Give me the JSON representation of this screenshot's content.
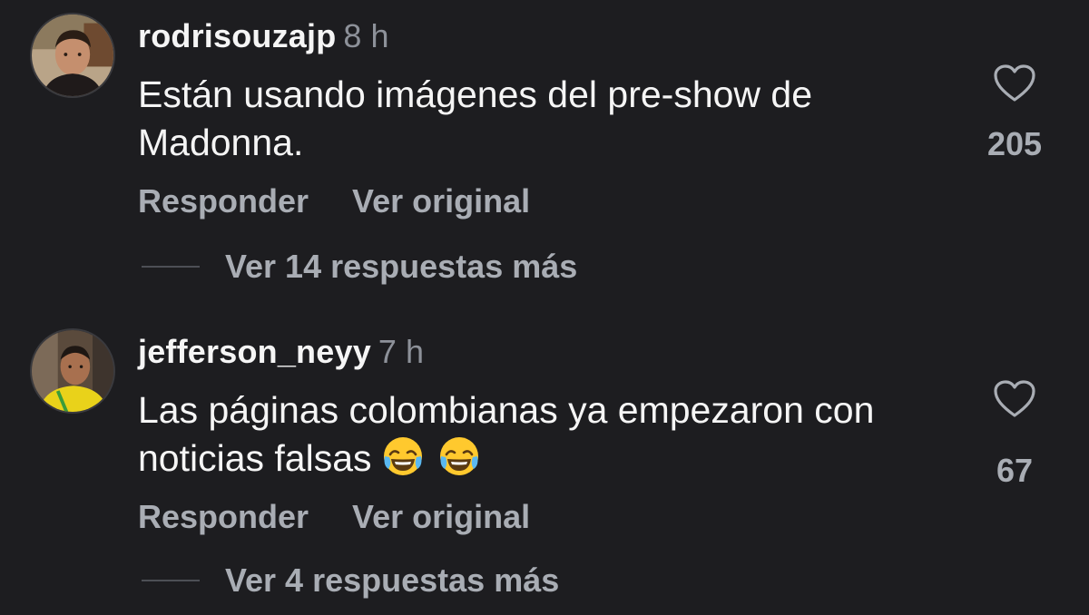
{
  "comments": [
    {
      "username": "rodrisouzajp",
      "timestamp": "8 h",
      "text": "Están usando imágenes del pre-show de Madonna.",
      "likes": "205",
      "reply_label": "Responder",
      "translate_label": "Ver original",
      "more_replies_label": "Ver 14 respuestas más",
      "avatar_icon": "user-avatar-photo"
    },
    {
      "username": "jefferson_neyy",
      "timestamp": "7 h",
      "text": "Las páginas colombianas ya empezaron con noticias falsas",
      "emojis": [
        "😂",
        "😂"
      ],
      "likes": "67",
      "reply_label": "Responder",
      "translate_label": "Ver original",
      "more_replies_label": "Ver 4 respuestas más",
      "avatar_icon": "user-avatar-photo"
    }
  ],
  "icons": {
    "like": "heart-outline-icon",
    "emoji": "face-with-tears-of-joy-emoji"
  },
  "colors": {
    "background": "#1d1d20",
    "primary_text": "#f5f5f5",
    "secondary_text": "#a9adb4",
    "timestamp": "#8d9199"
  }
}
